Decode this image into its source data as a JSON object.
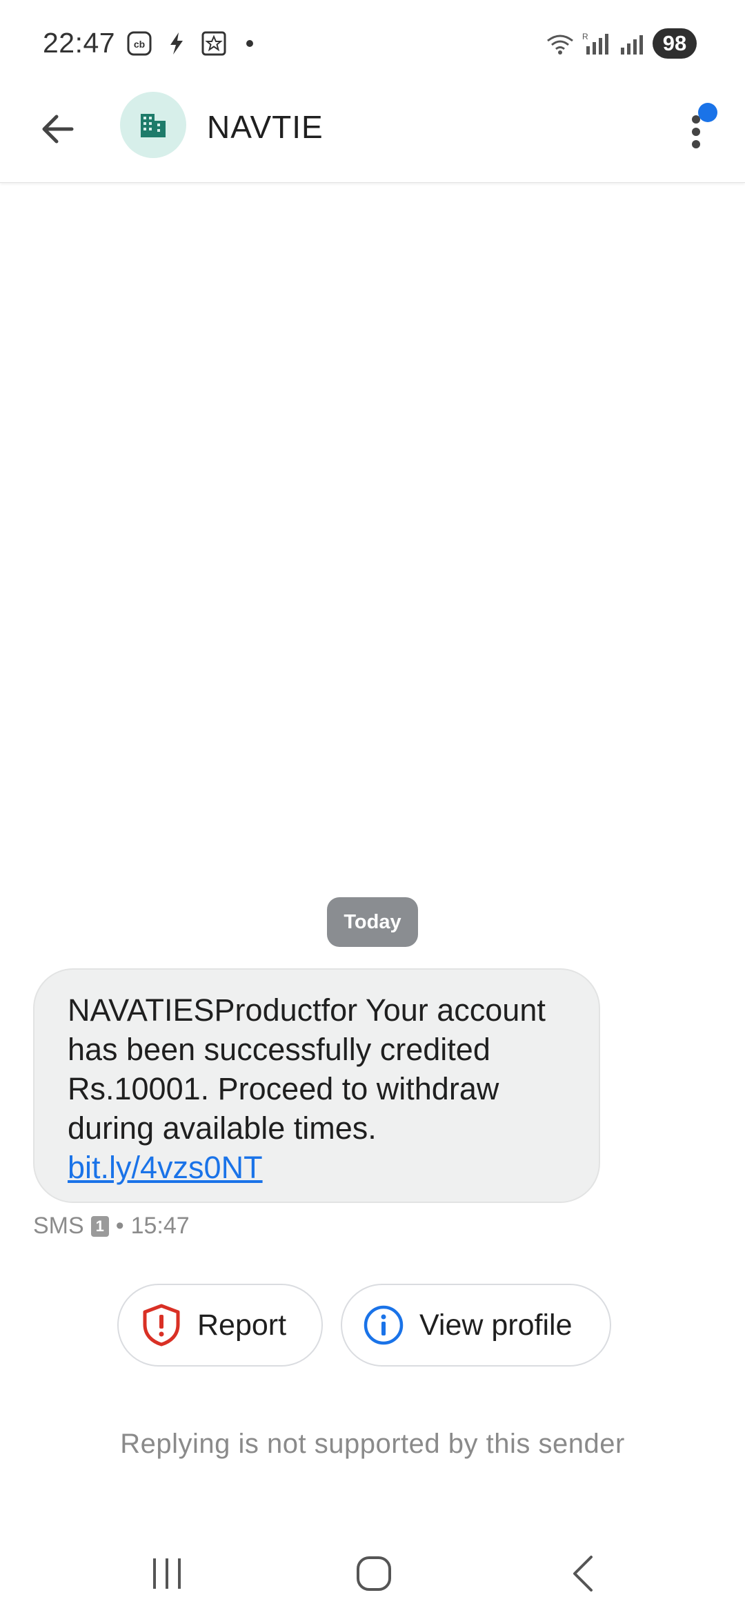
{
  "status_bar": {
    "time": "22:47",
    "left_icons": [
      "cb-app-icon",
      "flash-icon",
      "star-badge-icon"
    ],
    "right_icons": [
      "wifi-icon",
      "signal-sim1-icon",
      "signal-sim2-icon"
    ],
    "battery": "98"
  },
  "app_bar": {
    "contact_name": "NAVTIE",
    "avatar_icon": "building-icon",
    "avatar_bg": "#d7efea",
    "avatar_fg": "#1e7b6a",
    "notification_dot_color": "#1a73e8"
  },
  "conversation": {
    "date_label": "Today",
    "message": {
      "text": "NAVATIESProductfor Your account has been successfully credited Rs.10001. Proceed to withdraw during available times.",
      "link": "bit.ly/4vzs0NT",
      "type": "SMS",
      "sim": "1",
      "separator": "•",
      "time": "15:47"
    },
    "actions": {
      "report_label": "Report",
      "view_profile_label": "View profile"
    },
    "reply_note": "Replying is not supported by this sender"
  },
  "colors": {
    "link": "#1a73e8",
    "report_icon": "#d93025",
    "info_icon": "#1a73e8",
    "bubble_bg": "#eff0f0"
  }
}
